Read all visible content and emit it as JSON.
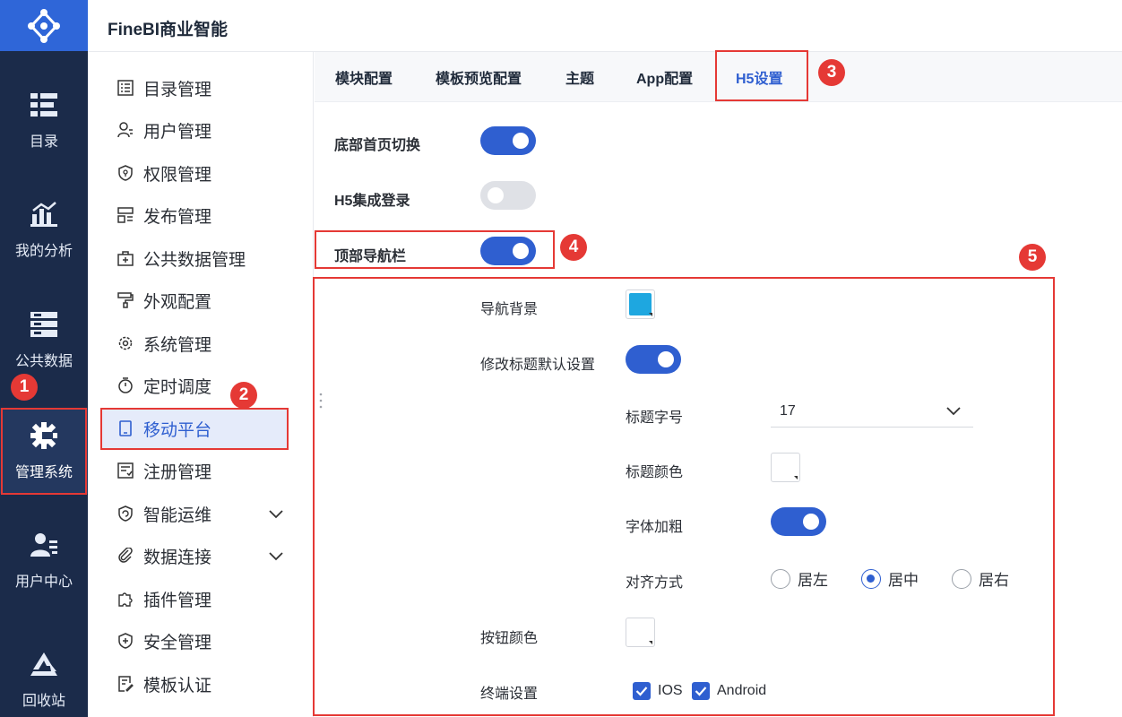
{
  "app": {
    "title": "FineBI商业智能"
  },
  "rail": {
    "items": [
      {
        "label": "目录",
        "icon": "list-icon"
      },
      {
        "label": "我的分析",
        "icon": "analysis-chart-icon"
      },
      {
        "label": "公共数据",
        "icon": "database-icon"
      },
      {
        "label": "管理系统",
        "icon": "gear-icon"
      },
      {
        "label": "用户中心",
        "icon": "user-icon"
      },
      {
        "label": "回收站",
        "icon": "recycle-icon"
      }
    ],
    "active": "管理系统"
  },
  "menu": {
    "items": [
      {
        "label": "目录管理",
        "icon": "catalog-icon"
      },
      {
        "label": "用户管理",
        "icon": "user-manage-icon"
      },
      {
        "label": "权限管理",
        "icon": "shield-icon"
      },
      {
        "label": "发布管理",
        "icon": "publish-icon"
      },
      {
        "label": "公共数据管理",
        "icon": "public-data-icon"
      },
      {
        "label": "外观配置",
        "icon": "paint-roller-icon"
      },
      {
        "label": "系统管理",
        "icon": "settings-icon"
      },
      {
        "label": "定时调度",
        "icon": "timer-icon"
      },
      {
        "label": "移动平台",
        "icon": "mobile-icon"
      },
      {
        "label": "注册管理",
        "icon": "register-icon"
      },
      {
        "label": "智能运维",
        "icon": "ops-icon"
      },
      {
        "label": "数据连接",
        "icon": "link-icon"
      },
      {
        "label": "插件管理",
        "icon": "plugin-icon"
      },
      {
        "label": "安全管理",
        "icon": "security-icon"
      },
      {
        "label": "模板认证",
        "icon": "template-cert-icon"
      }
    ],
    "active": "移动平台"
  },
  "tabs": {
    "items": [
      "模块配置",
      "模板预览配置",
      "主题",
      "App配置",
      "H5设置"
    ],
    "active": "H5设置"
  },
  "settings": {
    "bottom_home_switch": {
      "label": "底部首页切换",
      "on": true
    },
    "h5_login": {
      "label": "H5集成登录",
      "on": false
    },
    "top_nav": {
      "label": "顶部导航栏",
      "on": true
    },
    "nav_background": {
      "label": "导航背景",
      "color": "#1ea7e0"
    },
    "title_default": {
      "label": "修改标题默认设置",
      "on": true
    },
    "title_size": {
      "label": "标题字号",
      "value": "17"
    },
    "title_color": {
      "label": "标题颜色",
      "color": "#ffffff"
    },
    "bold_font": {
      "label": "字体加粗",
      "on": true
    },
    "alignment": {
      "label": "对齐方式",
      "options": [
        "居左",
        "居中",
        "居右"
      ],
      "selected": "居中"
    },
    "button_color": {
      "label": "按钮颜色",
      "color": "#ffffff"
    },
    "terminal": {
      "label": "终端设置",
      "options": [
        "IOS",
        "Android"
      ],
      "checked": [
        "IOS",
        "Android"
      ]
    }
  },
  "badges": [
    "1",
    "2",
    "3",
    "4",
    "5"
  ],
  "colors": {
    "accent": "#2f5fd0",
    "rail": "#1b2b4a",
    "annotation": "#e53935"
  }
}
